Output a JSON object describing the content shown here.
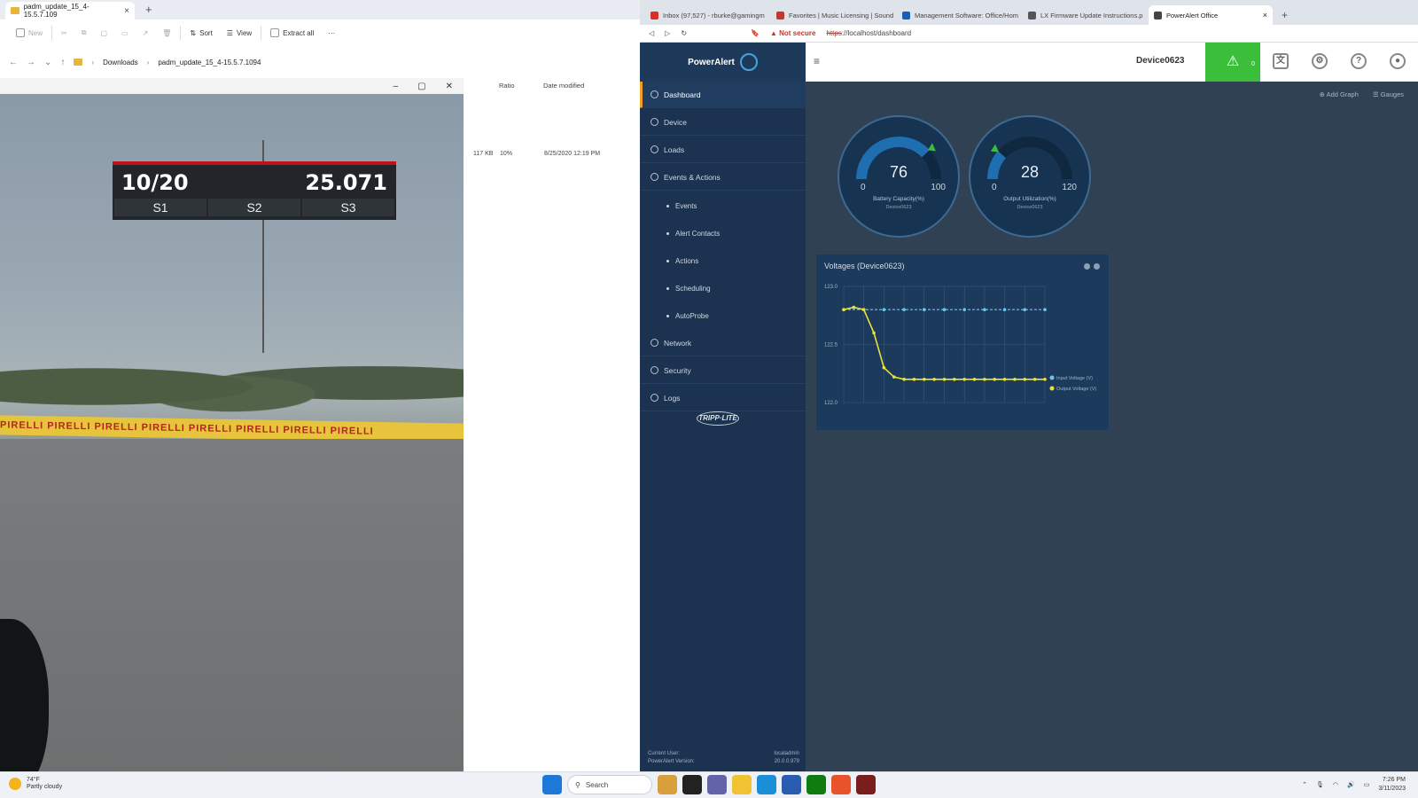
{
  "explorer": {
    "tab_title": "padm_update_15_4-15.5.7.109",
    "toolbar": {
      "new": "New",
      "sort": "Sort",
      "view": "View",
      "extract_all": "Extract all",
      "more": "···"
    },
    "breadcrumb": [
      "Downloads",
      "padm_update_15_4-15.5.7.1094"
    ],
    "columns": {
      "ratio": "Ratio",
      "date_modified": "Date modified"
    },
    "row": {
      "size": "117 KB",
      "ratio": "10%",
      "date": "8/25/2020 12:19 PM"
    }
  },
  "game": {
    "lap": "10/20",
    "time": "25.071",
    "sectors": [
      "S1",
      "S2",
      "S3"
    ],
    "barrier_text": "PIRELLI  PIRELLI  PIRELLI  PIRELLI  PIRELLI  PIRELLI  PIRELLI  PIRELLI"
  },
  "browser": {
    "tabs": [
      {
        "label": "Inbox (97,527) - rburke@gamingm",
        "color": "#d93025"
      },
      {
        "label": "Favorites | Music Licensing | Sound",
        "color": "#c0392b"
      },
      {
        "label": "Management Software: Office/Hom",
        "color": "#1a5fb4"
      },
      {
        "label": "LX Firmware Update Instructions.p",
        "color": "#555555"
      },
      {
        "label": "PowerAlert Office",
        "color": "#444444"
      }
    ],
    "not_secure": "Not secure",
    "url_scheme": "https",
    "url_rest": "://localhost/dashboard"
  },
  "app": {
    "logo": "PowerAlert",
    "logo_sub": "Office",
    "device_name": "Device0623",
    "alert_count": "0",
    "accent": "#3bbf3b",
    "sidebar": [
      {
        "label": "Dashboard",
        "icon": "dashboard-icon"
      },
      {
        "label": "Device",
        "icon": "device-icon"
      },
      {
        "label": "Loads",
        "icon": "loads-icon"
      },
      {
        "label": "Events & Actions",
        "icon": "events-icon"
      },
      {
        "label": "Network",
        "icon": "wifi-icon"
      },
      {
        "label": "Security",
        "icon": "shield-icon"
      },
      {
        "label": "Logs",
        "icon": "logs-icon"
      }
    ],
    "subitems": [
      "Events",
      "Alert Contacts",
      "Actions",
      "Scheduling",
      "AutoProbe"
    ],
    "brand": "TRIPP·LITE",
    "footer": {
      "user_label": "Current User:",
      "version_label": "PowerAlert Version:",
      "user": "localadmin",
      "version": "20.0.0.979"
    },
    "main_actions": {
      "add_graph": "Add Graph",
      "gauges": "Gauges"
    },
    "gauges": [
      {
        "value": "76",
        "min": "0",
        "max": "100",
        "label": "Battery Capacity(%)",
        "device": "Device0623",
        "fraction": 0.76
      },
      {
        "value": "28",
        "min": "0",
        "max": "120",
        "label": "Output Utilization(%)",
        "device": "Device0623",
        "fraction": 0.23
      }
    ]
  },
  "chart_data": {
    "type": "line",
    "title": "Voltages (Device0623)",
    "yticks": [
      "123.0",
      "122.5",
      "122.0"
    ],
    "ylim": [
      122.0,
      123.0
    ],
    "x": [
      0,
      1,
      2,
      3,
      4,
      5,
      6,
      7,
      8,
      9,
      10,
      11,
      12,
      13,
      14,
      15,
      16,
      17,
      18,
      19,
      20
    ],
    "series": [
      {
        "name": "Input Voltage (V)",
        "color": "#6ec3f0",
        "values": [
          122.8,
          122.8,
          122.8,
          122.8,
          122.8,
          122.8,
          122.8,
          122.8,
          122.8,
          122.8,
          122.8,
          122.8,
          122.8,
          122.8,
          122.8,
          122.8,
          122.8,
          122.8,
          122.8,
          122.8,
          122.8
        ]
      },
      {
        "name": "Output Voltage (V)",
        "color": "#e8e23a",
        "values": [
          122.8,
          122.82,
          122.8,
          122.6,
          122.3,
          122.22,
          122.2,
          122.2,
          122.2,
          122.2,
          122.2,
          122.2,
          122.2,
          122.2,
          122.2,
          122.2,
          122.2,
          122.2,
          122.2,
          122.2,
          122.2
        ]
      }
    ]
  },
  "taskbar": {
    "temp": "74°F",
    "weather": "Partly cloudy",
    "search": "Search",
    "time": "7:26 PM",
    "date": "3/11/2023"
  }
}
